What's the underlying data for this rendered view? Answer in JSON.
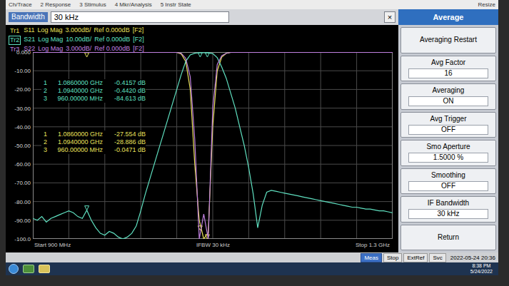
{
  "window": {
    "resize": "Resize"
  },
  "menu": [
    "Ch/Trace",
    "2 Response",
    "3 Stimulus",
    "4 Mkr/Analysis",
    "5 Instr State"
  ],
  "entry": {
    "label": "Bandwidth",
    "value": "30 kHz",
    "close": "×"
  },
  "softkeys": {
    "title": "Average",
    "items": [
      {
        "kind": "action",
        "label": "Averaging Restart"
      },
      {
        "kind": "setting",
        "label": "Avg Factor",
        "value": "16"
      },
      {
        "kind": "setting",
        "label": "Averaging",
        "value": "ON"
      },
      {
        "kind": "setting",
        "label": "Avg Trigger",
        "value": "OFF"
      },
      {
        "kind": "setting",
        "label": "Smo Aperture",
        "value": "1.5000 %"
      },
      {
        "kind": "setting",
        "label": "Smoothing",
        "value": "OFF"
      },
      {
        "kind": "setting",
        "label": "IF Bandwidth",
        "value": "30 kHz"
      },
      {
        "kind": "action",
        "label": "Return"
      }
    ]
  },
  "chart": {
    "y_ticks": [
      "0.000",
      "-10.00",
      "-20.00",
      "-30.00",
      "-40.00",
      "-50.00",
      "-60.00",
      "-70.00",
      "-80.00",
      "-90.00",
      "-100.0"
    ],
    "start": "Start 900 MHz",
    "ifbw": "IFBW 30 kHz",
    "stop": "Stop 1.3 GHz",
    "traces": [
      {
        "id": "Tr1",
        "param": "S11",
        "format": "Log Mag",
        "scale": "3.000dB/",
        "ref": "Ref 0.000dB",
        "channel": "[F2]",
        "color": "#e8e05a",
        "active": false,
        "values": [
          -0.05,
          -0.05,
          -0.05,
          -0.05,
          -0.05,
          -0.05,
          -0.05,
          -0.05,
          -0.05,
          -0.05,
          -0.05,
          -0.05,
          -0.05,
          -0.05,
          -0.05,
          -0.05,
          -0.05,
          -0.05,
          -0.05,
          -0.05,
          -0.05,
          -0.05,
          -0.05,
          -0.05,
          -0.05,
          -0.05,
          -0.05,
          -0.05,
          -0.05,
          -0.05,
          -0.05,
          -0.05,
          -0.05,
          -0.3,
          -1.5,
          -6,
          -18,
          -27,
          -35,
          -29,
          -12,
          -3,
          -0.8,
          -0.2,
          -0.05,
          -0.05,
          -0.05,
          -0.05,
          -0.05,
          -0.05,
          -0.05,
          -0.05,
          -0.05,
          -0.05,
          -0.05,
          -0.05,
          -0.05,
          -0.05,
          -0.05,
          -0.05,
          -0.05,
          -0.05,
          -0.05,
          -0.05,
          -0.05,
          -0.05,
          -0.05,
          -0.05,
          -0.05,
          -0.05,
          -0.05,
          -0.05,
          -0.05,
          -0.05,
          -0.05,
          -0.05,
          -0.05,
          -0.05,
          -0.05,
          -0.05,
          -0.05
        ],
        "markers": [
          {
            "number": "1",
            "frequency": "1.0860000 GHz",
            "value": "-27.554 dB"
          },
          {
            "number": "2",
            "frequency": "1.0940000 GHz",
            "value": "-28.886 dB"
          },
          {
            "number": "3",
            "frequency": "960.00000 MHz",
            "value": "-0.0471 dB"
          }
        ]
      },
      {
        "id": "Tr2",
        "param": "S21",
        "format": "Log Mag",
        "scale": "10.00dB/",
        "ref": "Ref 0.000dB",
        "channel": "[F2]",
        "color": "#5fe0c0",
        "active": true,
        "values": [
          -89,
          -90,
          -88,
          -91,
          -89,
          -88,
          -87,
          -86,
          -85,
          -86,
          -88,
          -89,
          -84.6,
          -90,
          -94,
          -97,
          -98,
          -96,
          -97,
          -99,
          -100,
          -99,
          -97,
          -93,
          -85,
          -76,
          -68,
          -60,
          -52,
          -44,
          -36,
          -28,
          -20,
          -12,
          -5,
          -1.5,
          -0.6,
          -0.4,
          -0.3,
          -0.45,
          -0.8,
          -3,
          -8,
          -14,
          -22,
          -30,
          -40,
          -50,
          -62,
          -76,
          -94,
          -82,
          -75,
          -74,
          -74.5,
          -75,
          -75.5,
          -76,
          -76.5,
          -77,
          -77.5,
          -78,
          -78.5,
          -79,
          -79.5,
          -80,
          -80.5,
          -81,
          -81.5,
          -82,
          -82.5,
          -83,
          -83,
          -83.5,
          -84,
          -84,
          -84.5,
          -85,
          -85,
          -85.5,
          -86
        ],
        "markers": [
          {
            "number": "1",
            "frequency": "1.0860000 GHz",
            "value": "-0.4157 dB"
          },
          {
            "number": "2",
            "frequency": "1.0940000 GHz",
            "value": "-0.4420 dB"
          },
          {
            "number": "3",
            "frequency": "960.00000 MHz",
            "value": "-84.613 dB"
          }
        ]
      },
      {
        "id": "Tr3",
        "param": "S22",
        "format": "Log Mag",
        "scale": "3.000dB/",
        "ref": "Ref 0.000dB",
        "channel": "[F2]",
        "color": "#c080e0",
        "active": false,
        "values": [
          -0.05,
          -0.05,
          -0.05,
          -0.05,
          -0.05,
          -0.05,
          -0.05,
          -0.05,
          -0.05,
          -0.05,
          -0.05,
          -0.05,
          -0.05,
          -0.05,
          -0.05,
          -0.05,
          -0.05,
          -0.05,
          -0.05,
          -0.05,
          -0.05,
          -0.05,
          -0.05,
          -0.05,
          -0.05,
          -0.05,
          -0.05,
          -0.05,
          -0.05,
          -0.05,
          -0.05,
          -0.05,
          -0.05,
          -0.2,
          -1,
          -4,
          -14,
          -30,
          -26,
          -33,
          -9,
          -2,
          -0.6,
          -0.2,
          -0.05,
          -0.05,
          -0.05,
          -0.05,
          -0.05,
          -0.05,
          -0.05,
          -0.05,
          -0.05,
          -0.05,
          -0.05,
          -0.05,
          -0.05,
          -0.05,
          -0.05,
          -0.05,
          -0.05,
          -0.05,
          -0.05,
          -0.05,
          -0.05,
          -0.05,
          -0.05,
          -0.05,
          -0.05,
          -0.05,
          -0.05,
          -0.05,
          -0.05,
          -0.05,
          -0.05,
          -0.05,
          -0.05,
          -0.05,
          -0.05,
          -0.05,
          -0.05
        ],
        "markers": []
      }
    ]
  },
  "status_bar": {
    "items": [
      {
        "label": "Meas",
        "highlighted": true
      },
      {
        "label": "Stop",
        "highlighted": false
      },
      {
        "label": "ExtRef",
        "highlighted": false
      },
      {
        "label": "Svc",
        "highlighted": false
      }
    ],
    "datetime": "2022-05-24 20:36"
  },
  "taskbar": {
    "time": "8:38 PM",
    "date": "5/24/2022"
  }
}
